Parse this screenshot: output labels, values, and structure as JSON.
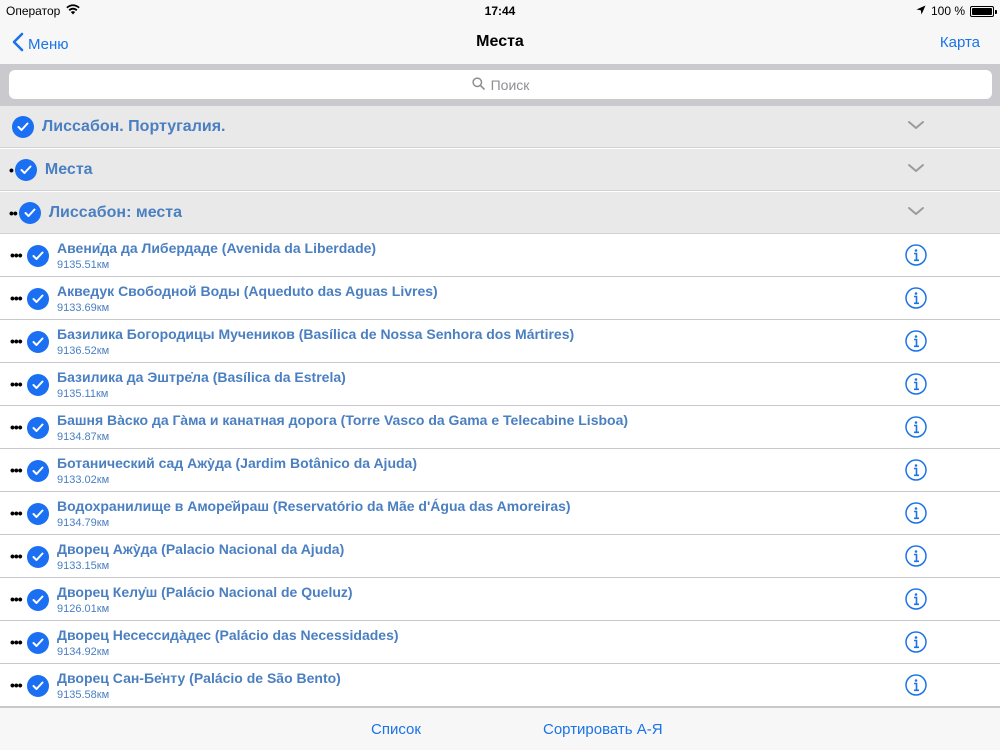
{
  "status_bar": {
    "carrier": "Оператор",
    "time": "17:44",
    "battery": "100 %",
    "battery_level": 1.0
  },
  "nav": {
    "back_label": "Меню",
    "title": "Места",
    "right_label": "Карта"
  },
  "search": {
    "placeholder": "Поиск"
  },
  "sections": [
    {
      "title": "Лиссабон. Португалия.",
      "prefix": ""
    },
    {
      "title": "Места",
      "prefix": "•"
    },
    {
      "title": "Лиссабон: места",
      "prefix": "••"
    }
  ],
  "items": [
    {
      "name": "Авени̇да да Либердаде (Avenida da Liberdade)",
      "distance": "9135.51км"
    },
    {
      "name": "Акведук Свободной Воды (Aqueduto das Aguas Livres)",
      "distance": "9133.69км"
    },
    {
      "name": "Базилика Богородицы Мучеников (Basílica de Nossa Senhora dos Mártires)",
      "distance": "9136.52км"
    },
    {
      "name": "Базилика да Эштре̇ла (Basílica da Estrela)",
      "distance": "9135.11км"
    },
    {
      "name": "Башня Ва̀ско да Га̀ма и канатная дорога (Torre Vasco da Gama e Telecabine Lisboa)",
      "distance": "9134.87км"
    },
    {
      "name": "Ботанический сад Ажу̀да (Jardim Botânico da Ajuda)",
      "distance": "9133.02км"
    },
    {
      "name": "Водохранилище  в Аморе̇йраш (Reservatório da Mãe d'Água das Amoreiras)",
      "distance": "9134.79км"
    },
    {
      "name": "Дворец Ажу̀да (Palacio Nacional da Ajuda)",
      "distance": "9133.15км"
    },
    {
      "name": "Дворец Келу̇ш (Palácio Nacional de Queluz)",
      "distance": "9126.01км"
    },
    {
      "name": "Дворец Несессида̀дес (Palácio das Necessidades)",
      "distance": "9134.92км"
    },
    {
      "name": "Дворец Сан-Бе̇нту (Palácio de São Bento)",
      "distance": "9135.58км"
    }
  ],
  "toolbar": {
    "list_label": "Список",
    "sort_label": "Сортировать А-Я"
  },
  "colors": {
    "accent": "#1a73e8",
    "item_text": "#4a7fc1",
    "check": "#1a6ff2",
    "section_bg": "#e9e9ea"
  },
  "icons": {
    "check": "checkmark-circle-icon",
    "info": "info-circle-icon",
    "chevron": "chevron-down-icon",
    "back": "chevron-left-icon",
    "search": "search-icon"
  }
}
